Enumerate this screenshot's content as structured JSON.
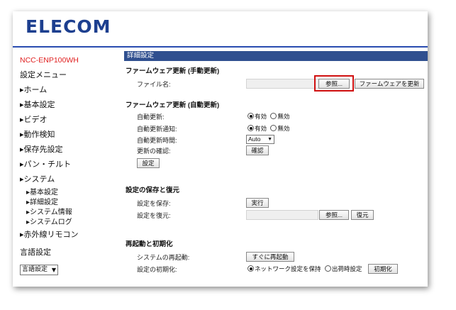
{
  "brand": {
    "logo_text": "ELECOM"
  },
  "sidebar": {
    "model": "NCC-ENP100WH",
    "menu_title": "設定メニュー",
    "items": [
      {
        "label": "▸ホーム"
      },
      {
        "label": "▸基本設定"
      },
      {
        "label": "▸ビデオ"
      },
      {
        "label": "▸動作検知"
      },
      {
        "label": "▸保存先設定"
      },
      {
        "label": "▸パン・チルト"
      },
      {
        "label": "▸システム"
      }
    ],
    "sub_items": [
      {
        "label": "▸基本設定"
      },
      {
        "label": "▸詳細設定"
      },
      {
        "label": "▸システム情報"
      },
      {
        "label": "▸システムログ"
      }
    ],
    "ir_remote": "▸赤外線リモコン",
    "lang_title": "言語設定",
    "lang_select": "言語設定"
  },
  "main": {
    "page_title": "詳細設定",
    "manual_fw": {
      "title": "ファームウェア更新 (手動更新)",
      "file_label": "ファイル名:",
      "browse_button": "参照...",
      "update_button": "ファームウェアを更新"
    },
    "auto_fw": {
      "title": "ファームウェア更新 (自動更新)",
      "auto_update_label": "自動更新:",
      "auto_update_notice_label": "自動更新通知:",
      "auto_update_time_label": "自動更新時間:",
      "check_label": "更新の確認:",
      "enable": "有効",
      "disable": "無効",
      "time_value": "Auto",
      "confirm_button": "確認",
      "set_button": "設定"
    },
    "backup": {
      "title": "設定の保存と復元",
      "save_label": "設定を保存:",
      "restore_label": "設定を復元:",
      "run_button": "実行",
      "browse_button": "参照...",
      "restore_button": "復元"
    },
    "reboot": {
      "title": "再起動と初期化",
      "reboot_label": "システムの再起動:",
      "reboot_button": "すぐに再起動",
      "init_label": "設定の初期化:",
      "keep_network": "ネットワーク設定を保持",
      "factory": "出荷時設定",
      "init_button": "初期化"
    }
  },
  "colors": {
    "brand": "#1d3f8f",
    "title_bar": "#2f4f8f",
    "model": "#e02020",
    "highlight": "#d01010"
  }
}
